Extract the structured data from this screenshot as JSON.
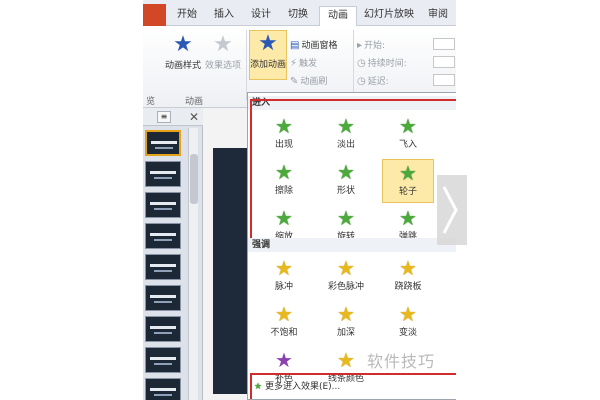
{
  "tabs": [
    {
      "label": "开始"
    },
    {
      "label": "插入"
    },
    {
      "label": "设计"
    },
    {
      "label": "切换"
    },
    {
      "label": "动画"
    },
    {
      "label": "幻灯片放映"
    },
    {
      "label": "审阅"
    }
  ],
  "active_tab": "动画",
  "ribbon": {
    "animation_styles_label": "动画样式",
    "effect_options_label": "效果选项",
    "add_animation_label": "添加动画",
    "animation_pane_label": "动画窗格",
    "trigger_label": "触发",
    "animation_painter_label": "动画刷",
    "start_label": "开始:",
    "duration_label": "持续时间:",
    "delay_label": "延迟:",
    "group_animation_label": "动画",
    "group_left_partial": "览"
  },
  "left_panel": {
    "thumbnail_count": 9,
    "selected_index": 0
  },
  "dropdown": {
    "enter_section": "进入",
    "enter_effects": [
      {
        "label": "出现",
        "color": "g"
      },
      {
        "label": "淡出",
        "color": "g"
      },
      {
        "label": "飞入",
        "color": "g"
      },
      {
        "label": "擦除",
        "color": "g"
      },
      {
        "label": "形状",
        "color": "g"
      },
      {
        "label": "轮子",
        "color": "g"
      },
      {
        "label": "缩放",
        "color": "g"
      },
      {
        "label": "旋转",
        "color": "g"
      },
      {
        "label": "弹跳",
        "color": "g"
      }
    ],
    "emphasis_section": "强调",
    "emphasis_effects": [
      {
        "label": "脉冲",
        "color": "y"
      },
      {
        "label": "彩色脉冲",
        "color": "y"
      },
      {
        "label": "跷跷板",
        "color": "y"
      },
      {
        "label": "不饱和",
        "color": "y"
      },
      {
        "label": "加深",
        "color": "y"
      },
      {
        "label": "变淡",
        "color": "y"
      },
      {
        "label": "补色",
        "color": "p"
      },
      {
        "label": "线条颜色",
        "color": "y"
      }
    ],
    "more_enter_effects": "更多进入效果(E)..."
  },
  "colors": {
    "highlight_fill": "#fde9a8",
    "red_outline": "#d12b2b",
    "file_tab": "#d24726"
  },
  "watermark": "软件技巧"
}
